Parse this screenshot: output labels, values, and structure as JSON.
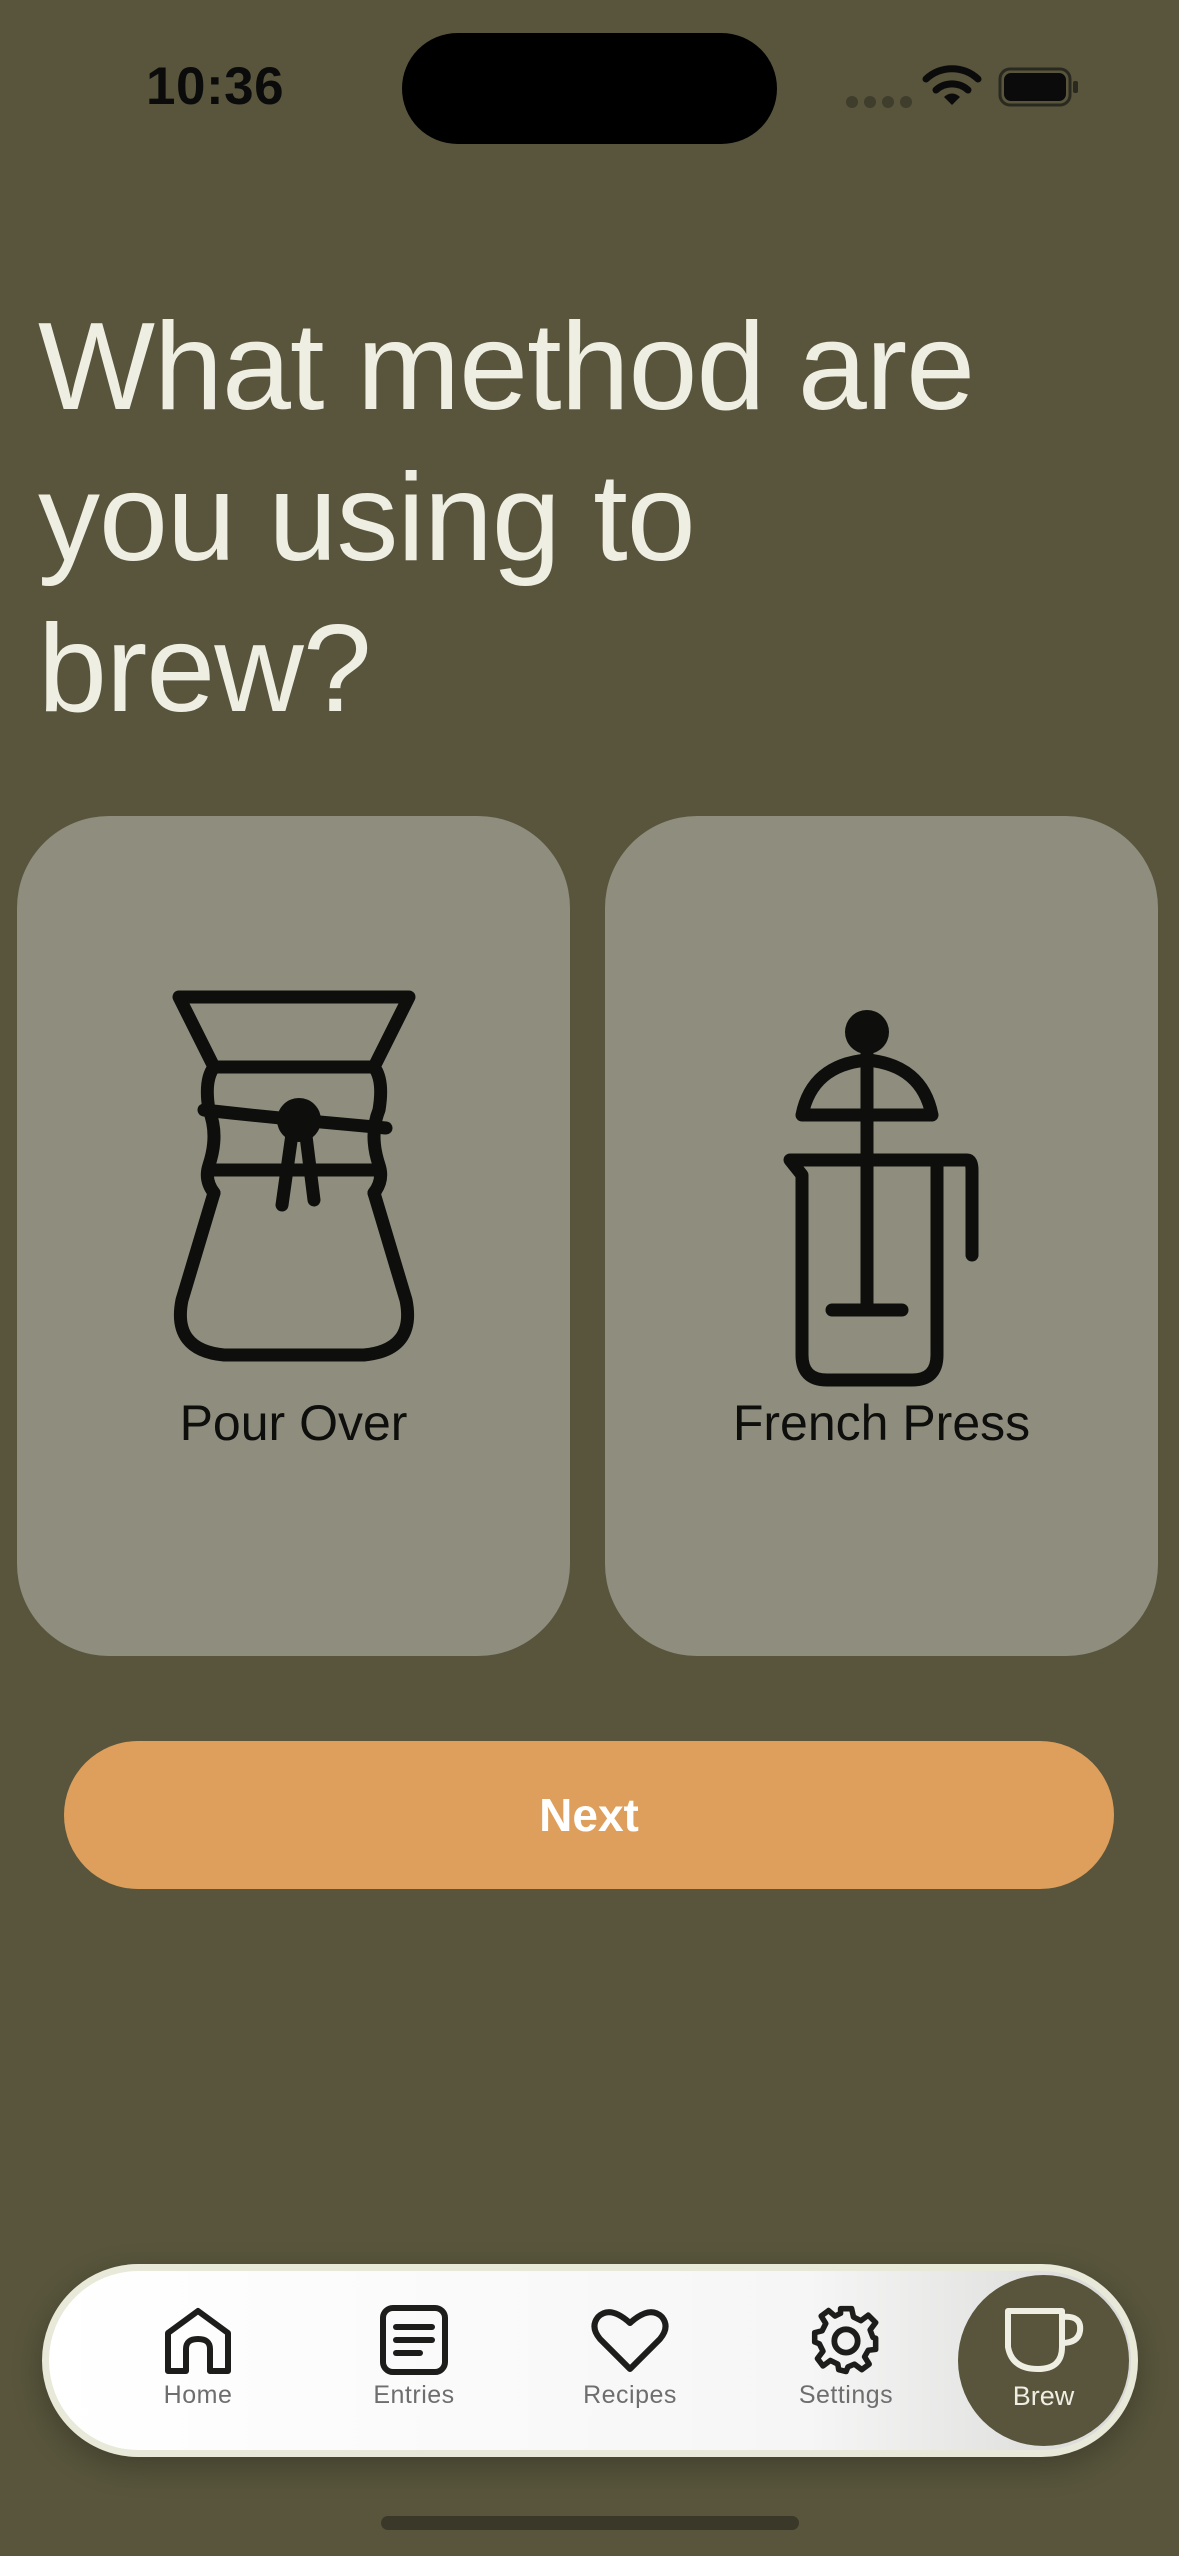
{
  "status_bar": {
    "time": "10:36"
  },
  "question": "What method are you using to brew?",
  "methods": [
    {
      "label": "Pour Over",
      "icon": "chemex-icon"
    },
    {
      "label": "French Press",
      "icon": "french-press-icon"
    }
  ],
  "next_button": {
    "label": "Next"
  },
  "tab_bar": {
    "items": [
      {
        "label": "Home",
        "icon": "home-icon"
      },
      {
        "label": "Entries",
        "icon": "list-icon"
      },
      {
        "label": "Recipes",
        "icon": "heart-icon"
      },
      {
        "label": "Settings",
        "icon": "gear-icon"
      },
      {
        "label": "Brew",
        "icon": "cup-icon",
        "active": true
      }
    ]
  },
  "colors": {
    "background": "#58553c",
    "card": "#8f8e7e",
    "accent": "#dd9f5b",
    "title_text": "#efeee2"
  }
}
